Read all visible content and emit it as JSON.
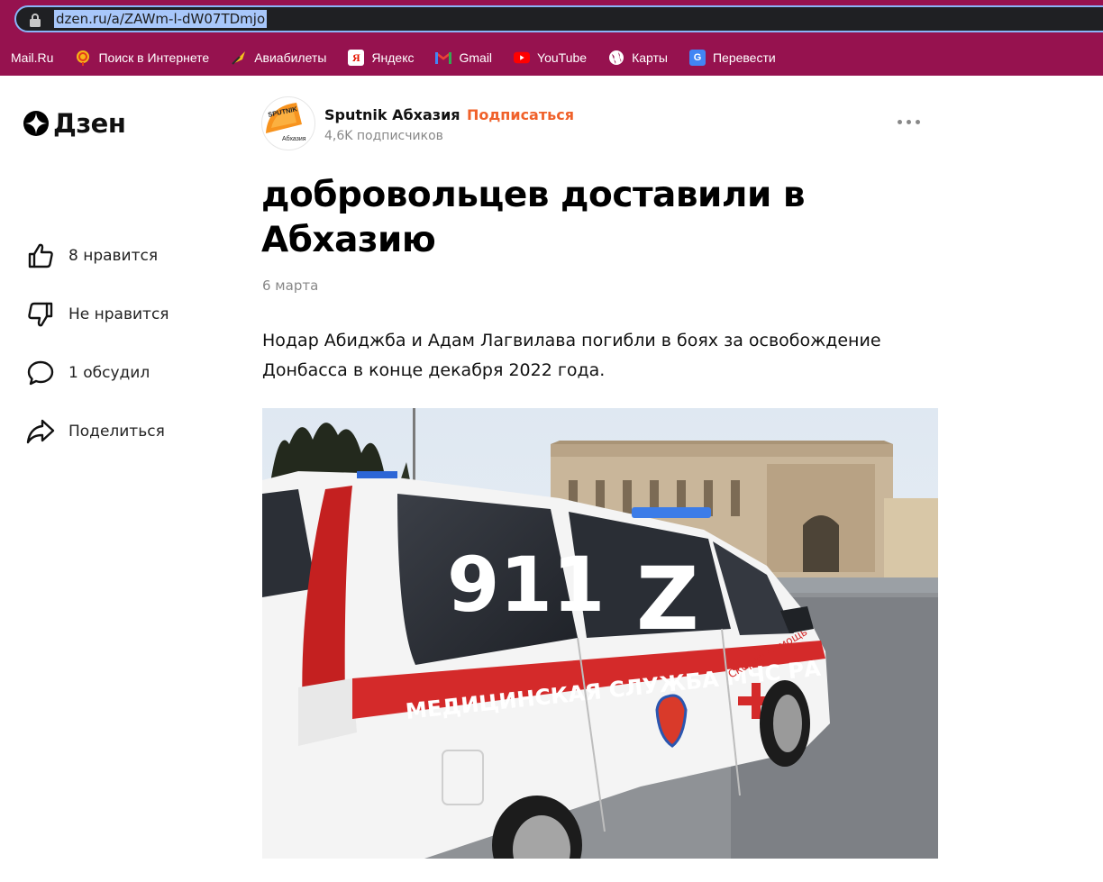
{
  "browser": {
    "url": "dzen.ru/a/ZAWm-l-dW07TDmjo",
    "bookmarks": [
      {
        "label": "Mail.Ru",
        "icon": "mailru-icon"
      },
      {
        "label": "Поиск в Интернете",
        "icon": "search-lollipop-icon"
      },
      {
        "label": "Авиабилеты",
        "icon": "plane-icon"
      },
      {
        "label": "Яндекс",
        "icon": "yandex-icon"
      },
      {
        "label": "Gmail",
        "icon": "gmail-icon"
      },
      {
        "label": "YouTube",
        "icon": "youtube-icon"
      },
      {
        "label": "Карты",
        "icon": "globe-icon"
      },
      {
        "label": "Перевести",
        "icon": "translate-icon"
      }
    ]
  },
  "logo": {
    "text": "Дзен"
  },
  "actions": {
    "like": "8 нравится",
    "dislike": "Не нравится",
    "comments": "1 обсудил",
    "share": "Поделиться"
  },
  "channel": {
    "name": "Sputnik Абхазия",
    "separator": "·",
    "subscribe": "Подписаться",
    "subscribers": "4,6K подписчиков",
    "avatar_top": "SPUTNIK",
    "avatar_bottom": "Абхазия"
  },
  "article": {
    "title": "добровольцев доставили в Абхазию",
    "date": "6 марта",
    "lead": "Нодар Абиджба и Адам Лагвилава погибли в боях за освобождение Донбасса в конце декабря 2022 года."
  },
  "photo": {
    "number": "911",
    "letter": "Z",
    "side_text": "МЕДИЦИНСКАЯ СЛУЖБА МЧС РА",
    "door_text": "Скорая помощь"
  },
  "colors": {
    "browser_chrome": "#96124f",
    "omnibox": "#1f2023",
    "url_highlight": "#a8c7fa",
    "subscribe": "#f0612a"
  }
}
